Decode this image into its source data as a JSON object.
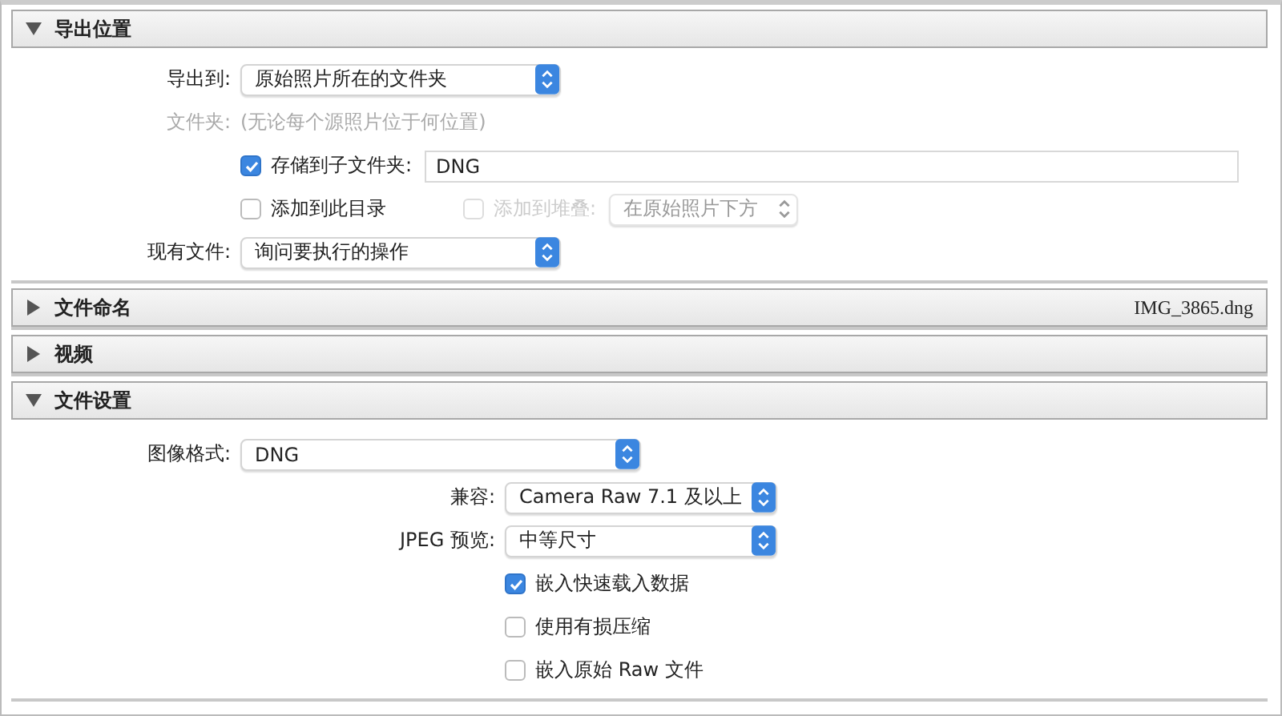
{
  "sections": [
    {
      "kind": "location",
      "title": "导出位置",
      "expanded": true,
      "rows": [
        {
          "kind": "select",
          "label": "导出到:",
          "value": "原始照片所在的文件夹"
        },
        {
          "kind": "note",
          "label": "文件夹:",
          "value": "(无论每个源照片位于何位置)"
        },
        {
          "kind": "check-field",
          "label": "存储到子文件夹:",
          "checked": true,
          "value": "DNG"
        },
        {
          "kind": "check-pair",
          "label": "添加到此目录",
          "checked": false,
          "label2": "添加到堆叠:",
          "checked2": false,
          "value": "在原始照片下方"
        },
        {
          "kind": "select",
          "label": "现有文件:",
          "value": "询问要执行的操作"
        }
      ]
    },
    {
      "title": "文件命名",
      "expanded": false,
      "summary": "IMG_3865.dng"
    },
    {
      "title": "视频",
      "expanded": false
    },
    {
      "kind": "settings",
      "title": "文件设置",
      "expanded": true,
      "rows": [
        {
          "kind": "wide-select",
          "label": "图像格式:",
          "value": "DNG"
        },
        {
          "kind": "sub-select",
          "label": "兼容:",
          "value": "Camera Raw 7.1 及以上"
        },
        {
          "kind": "sub-select",
          "label": "JPEG 预览:",
          "value": "中等尺寸"
        },
        {
          "kind": "check",
          "label": "嵌入快速载入数据",
          "checked": true
        },
        {
          "kind": "check",
          "label": "使用有损压缩",
          "checked": false
        },
        {
          "kind": "check",
          "label": "嵌入原始 Raw 文件",
          "checked": false
        }
      ]
    }
  ]
}
